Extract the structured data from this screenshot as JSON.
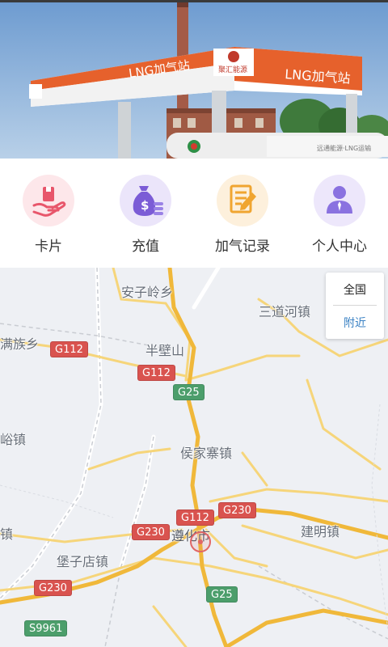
{
  "banner": {
    "station_sign_left": "LNG加气站",
    "station_sign_right": "LNG加气站",
    "brand_badge": "聚汇能源",
    "tanker_text": "远通能源·LNG运输"
  },
  "menu": {
    "items": [
      {
        "label": "卡片",
        "icon": "card-hand-icon",
        "color": "#e8566b"
      },
      {
        "label": "充值",
        "icon": "money-bag-icon",
        "color": "#7b5cd6"
      },
      {
        "label": "加气记录",
        "icon": "record-pen-icon",
        "color": "#f0a530"
      },
      {
        "label": "个人中心",
        "icon": "person-icon",
        "color": "#8a72e0"
      }
    ]
  },
  "map": {
    "places": [
      "安子岭乡",
      "三道河镇",
      "满族乡",
      "半壁山",
      "侯家寨镇",
      "峪镇",
      "遵化市",
      "建明镇",
      "镇",
      "堡子店镇"
    ],
    "shields": [
      "G112",
      "G112",
      "G25",
      "G112",
      "G230",
      "G230",
      "G230",
      "G25",
      "S9961"
    ],
    "scope_options": [
      "全国",
      "附近"
    ]
  }
}
